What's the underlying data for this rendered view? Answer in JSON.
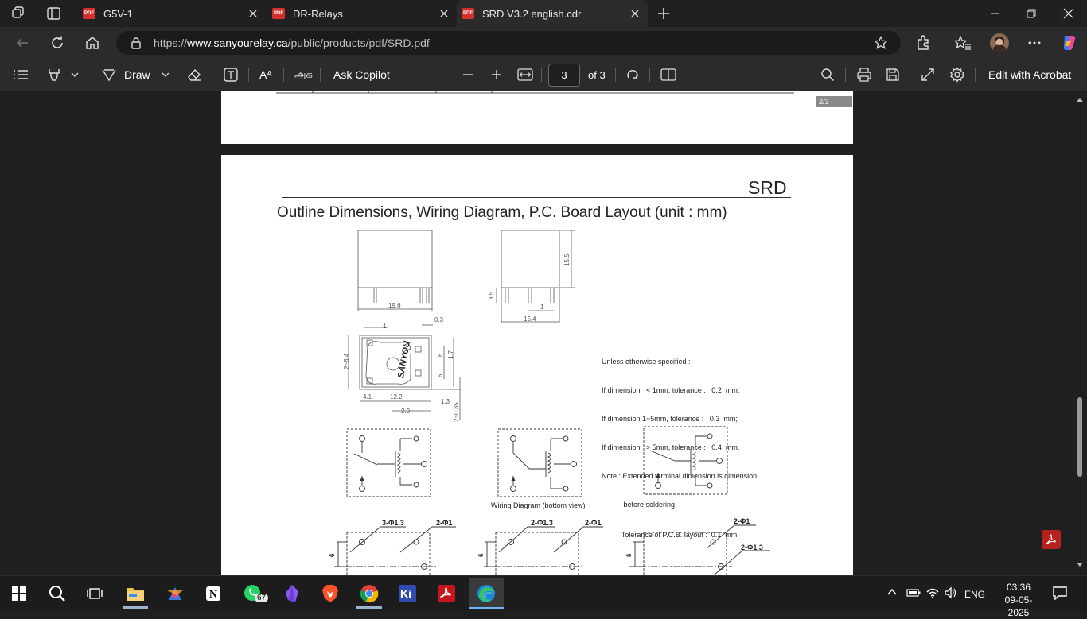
{
  "tabs": [
    {
      "title": "G5V-1",
      "active": false
    },
    {
      "title": "DR-Relays",
      "active": false
    },
    {
      "title": "SRD V3.2 english.cdr",
      "active": true
    }
  ],
  "favicon_label": "PDF",
  "address": {
    "scheme": "https://",
    "host": "www.sanyourelay.ca",
    "path": "/public/products/pdf/SRD.pdf"
  },
  "pdf_toolbar": {
    "draw_label": "Draw",
    "copilot_label": "Ask Copilot",
    "page_current": "3",
    "page_of": "of 3",
    "edit_acrobat": "Edit with Acrobat",
    "read_aloud_glyph": "Aᴬ",
    "translate_glyph": "அக"
  },
  "prev_page": {
    "page_badge": "2/3"
  },
  "document": {
    "header": "SRD",
    "title": "Outline Dimensions, Wiring Diagram, P.C. Board Layout (unit : mm)",
    "tolerance_notes": [
      "Unless otherwise specified :",
      "If dimension   < 1mm, tolerance :   0.2  mm;",
      "If dimension 1~5mm, tolerance :   0.3  mm;",
      "If dimension   > 5mm, tolerance :   0.4  mm.",
      "Note : Extended terminal dimension is dimension",
      "           before soldering.",
      "          Tolerance of P.C.B. layout :  0.1  mm."
    ],
    "wiring_caption": "Wiring Diagram (bottom view)",
    "relay_brand": "SANYOU",
    "dims": {
      "front_width": "19.6",
      "side_height": "15.5",
      "side_width": "15.4",
      "pin_len": "3.5",
      "pin_gap": "1",
      "top_w1": "1",
      "top_03": "0.3",
      "top_side": "2~6.4",
      "top_6a": "6",
      "top_6b": "6",
      "top_17": "1.7",
      "top_41": "4.1",
      "top_122": "12.2",
      "top_13": "1.3",
      "top_20": "2.0",
      "top_035": "2~0.35"
    },
    "pcb_labels": {
      "a1": "3-Φ1.3",
      "a2": "2-Φ1",
      "b1": "2-Φ1.3",
      "b2": "2-Φ1",
      "c1": "2-Φ1",
      "c2": "2-Φ1.3",
      "six": "6"
    }
  },
  "taskbar": {
    "whatsapp_badge": "67",
    "lang": "ENG",
    "time": "03:36",
    "date": "09-05-2025"
  },
  "colors": {
    "accent_blue": "#6fb5ff",
    "pdf_red": "#d32f2f",
    "chrome_dark": "#2b2b2b"
  }
}
